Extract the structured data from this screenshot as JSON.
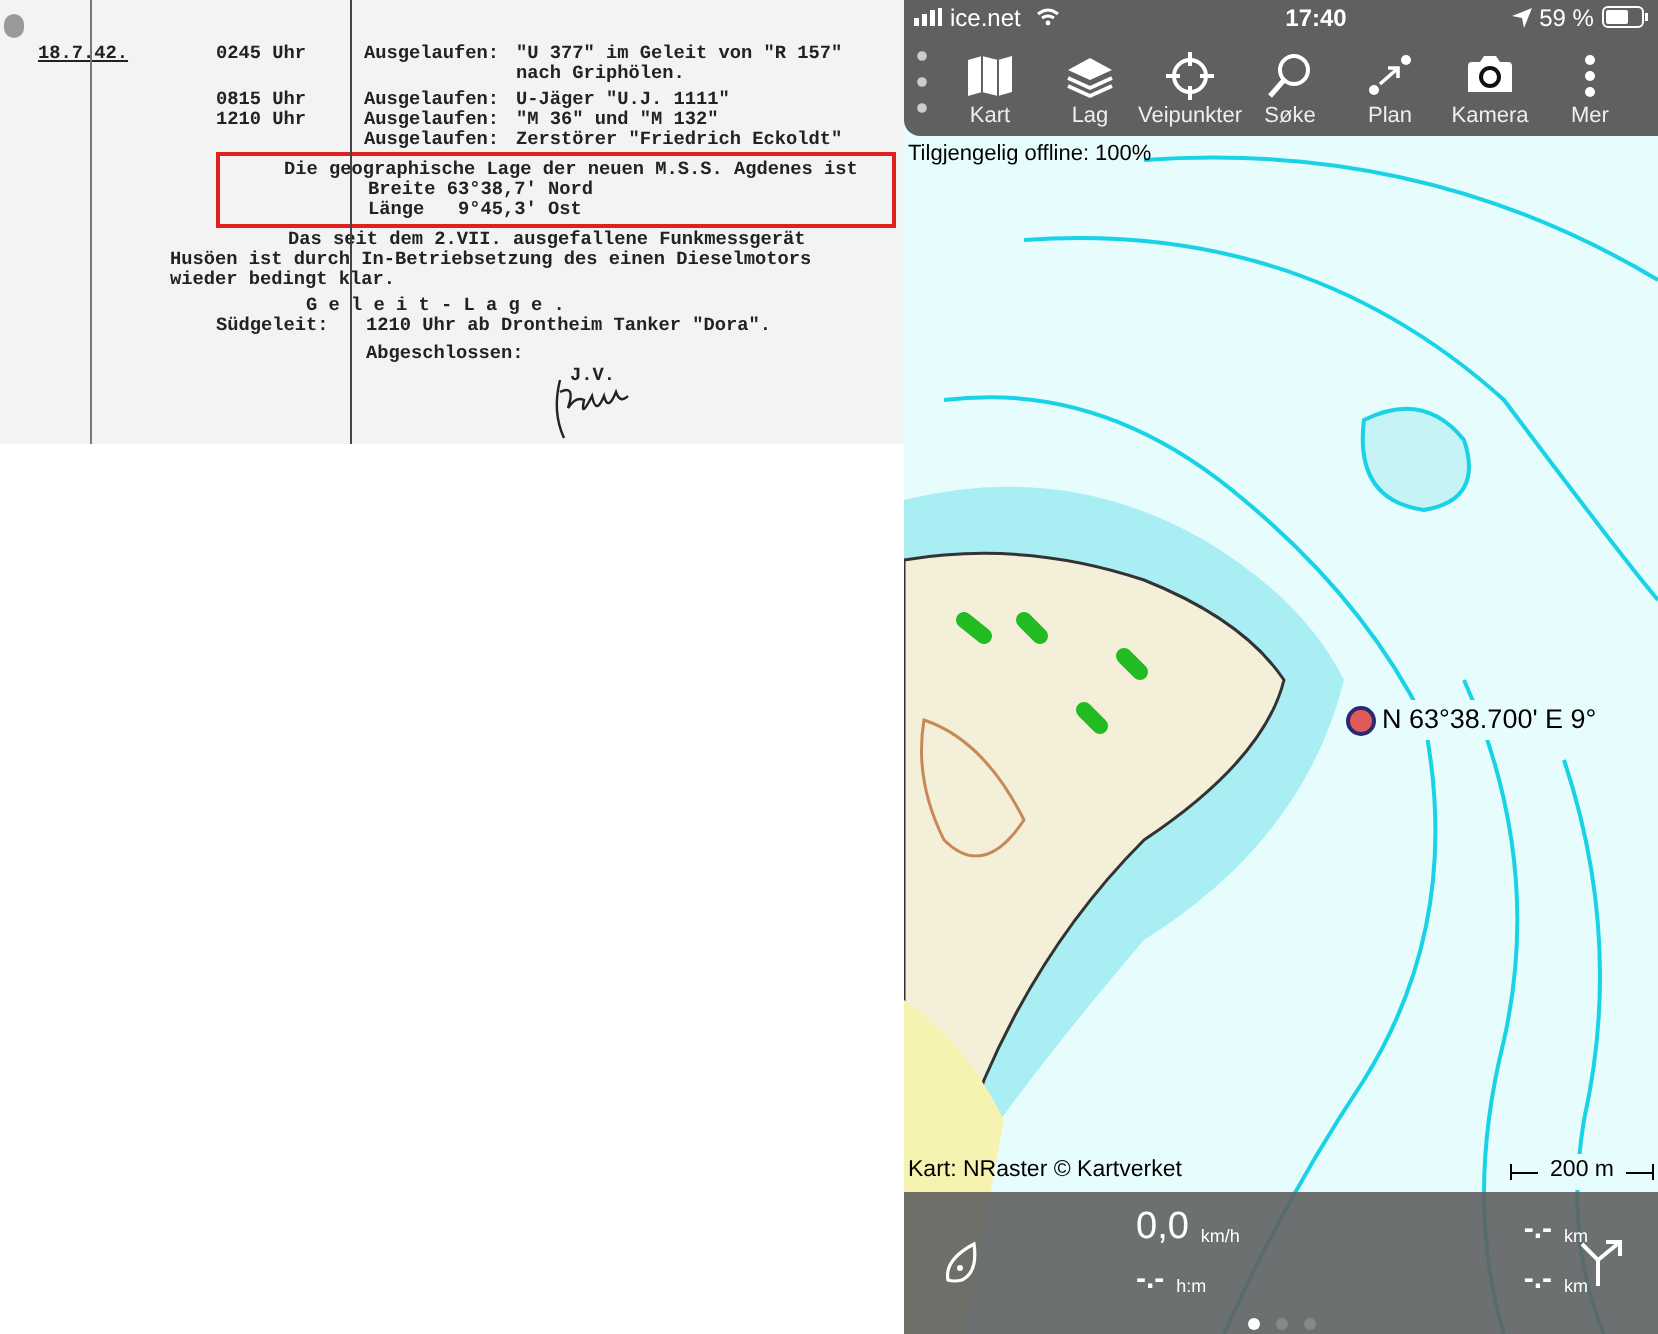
{
  "document": {
    "date": "18.7.42.",
    "entries": [
      {
        "time": "0245 Uhr",
        "label": "Ausgelaufen:",
        "lines": [
          "\"U 377\" im Geleit von \"R 157\"",
          "nach Griphölen."
        ]
      },
      {
        "time": "0815 Uhr",
        "label": "Ausgelaufen:",
        "lines": [
          "U-Jäger \"U.J. 1111\""
        ]
      },
      {
        "time": "1210 Uhr",
        "label": "Ausgelaufen:",
        "lines": [
          "\"M 36\" und \"M 132\""
        ]
      },
      {
        "label": "Ausgelaufen:",
        "lines": [
          "Zerstörer \"Friedrich Eckoldt\""
        ]
      }
    ],
    "highlight_lines": [
      "Die geographische Lage der neuen M.S.S. Agdenes ist",
      "Breite 63°38,7' Nord",
      "Länge   9°45,3' Ost"
    ],
    "paragraph_lines": [
      "Das seit dem 2.VII. ausgefallene Funkmessgerät",
      "Husöen ist durch In-Betriebsetzung des einen Dieselmotors",
      "wieder bedingt klar."
    ],
    "section_heading": "G e l e i t - L a g e .",
    "convoy": {
      "label": "Südgeleit:",
      "text": "1210 Uhr ab Drontheim Tanker \"Dora\"."
    },
    "closing": "Abgeschlossen:",
    "signer": "J.V."
  },
  "phone": {
    "status_bar": {
      "carrier": "ice.net",
      "time": "17:40",
      "battery": "59 %"
    },
    "toolbar": [
      {
        "kind": "map",
        "label": "Kart"
      },
      {
        "kind": "layers",
        "label": "Lag"
      },
      {
        "kind": "crosshair",
        "label": "Veipunkter"
      },
      {
        "kind": "search",
        "label": "Søke"
      },
      {
        "kind": "route",
        "label": "Plan"
      },
      {
        "kind": "camera",
        "label": "Kamera"
      },
      {
        "kind": "more",
        "label": "Mer"
      }
    ],
    "offline": "Tilgjengelig offline: 100%",
    "location_label": "N 63°38.700' E 9°",
    "attribution": "Kart: NRaster © Kartverket",
    "scale": "200 m",
    "stats": [
      {
        "value": "0,0",
        "unit": "km/h"
      },
      {
        "value": "-.-",
        "unit": "km"
      },
      {
        "value": "-.-",
        "unit": "h:m"
      },
      {
        "value": "-.-",
        "unit": "km"
      }
    ],
    "pages": [
      {
        "selected": true
      },
      {
        "selected": false
      },
      {
        "selected": false
      }
    ]
  }
}
